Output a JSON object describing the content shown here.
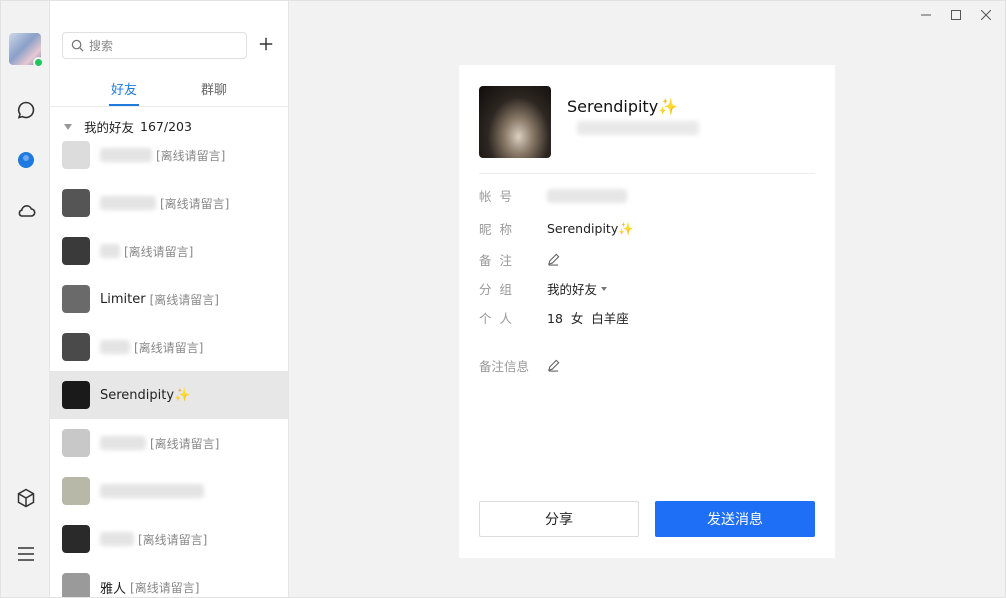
{
  "search": {
    "placeholder": "搜索"
  },
  "tabs": [
    {
      "label": "好友",
      "active": true
    },
    {
      "label": "群聊",
      "active": false
    }
  ],
  "group": {
    "name": "我的好友",
    "count": "167/203"
  },
  "contacts": [
    {
      "name": "",
      "status": "[离线请留言]",
      "avatar_color": "#dcdcdc"
    },
    {
      "name": "",
      "status": "[离线请留言]",
      "avatar_color": "#555555"
    },
    {
      "name": "",
      "status": "[离线请留言]",
      "avatar_color": "#3a3a3a"
    },
    {
      "name": "Limiter",
      "status": "[离线请留言]",
      "avatar_color": "#6a6a6a"
    },
    {
      "name": "",
      "status": "[离线请留言]",
      "avatar_color": "#4a4a4a"
    },
    {
      "name": "Serendipity✨",
      "status": "",
      "avatar_color": "#1a1a1a",
      "selected": true
    },
    {
      "name": "",
      "status": "[离线请留言]",
      "avatar_color": "#c8c8c8"
    },
    {
      "name": "",
      "status": "",
      "avatar_color": "#b8b8a8"
    },
    {
      "name": "",
      "status": "[离线请留言]",
      "avatar_color": "#2a2a2a"
    },
    {
      "name": "雅人",
      "status": "[离线请留言]",
      "avatar_color": "#9a9a9a"
    }
  ],
  "profile": {
    "name": "Serendipity✨",
    "fields": {
      "account_label": "帐  号",
      "nickname_label": "昵  称",
      "nickname_value": "Serendipity✨",
      "remark_label": "备  注",
      "group_label": "分  组",
      "group_value": "我的好友",
      "personal_label": "个  人",
      "personal_value": "18  女  白羊座",
      "remark_info_label": "备注信息"
    },
    "share_label": "分享",
    "send_label": "发送消息"
  },
  "colors": {
    "accent": "#1f7ae0",
    "send_button": "#1e6ef6",
    "online": "#21c45d"
  }
}
